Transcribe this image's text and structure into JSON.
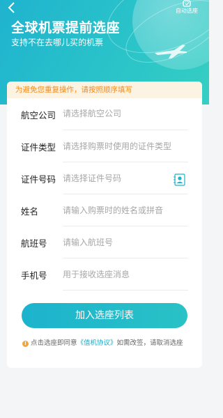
{
  "header": {
    "title": "全球机票提前选座",
    "subtitle": "支持不在去哪儿买的机票",
    "auto_select_label": "自动选座"
  },
  "notice": "为避免您重复操作，请按照顺序填写",
  "form": {
    "rows": [
      {
        "label": "航空公司",
        "placeholder": "请选择航空公司"
      },
      {
        "label": "证件类型",
        "placeholder": "请选择购票时使用的证件类型"
      },
      {
        "label": "证件号码",
        "placeholder": "请选择证件号码"
      },
      {
        "label": "姓名",
        "placeholder": "请输入购票时的姓名或拼音"
      },
      {
        "label": "航班号",
        "placeholder": "请输入航班号"
      },
      {
        "label": "手机号",
        "placeholder": "用于接收选座消息"
      }
    ]
  },
  "submit_label": "加入选座列表",
  "agreement": {
    "prefix": "点击选座即同意",
    "link": "《值机协议》",
    "suffix": "如需改签，请取消选座"
  },
  "colors": {
    "accent": "#1cb3cd",
    "notice_text": "#f08b1c",
    "notice_bg": "#fdf3e3"
  }
}
